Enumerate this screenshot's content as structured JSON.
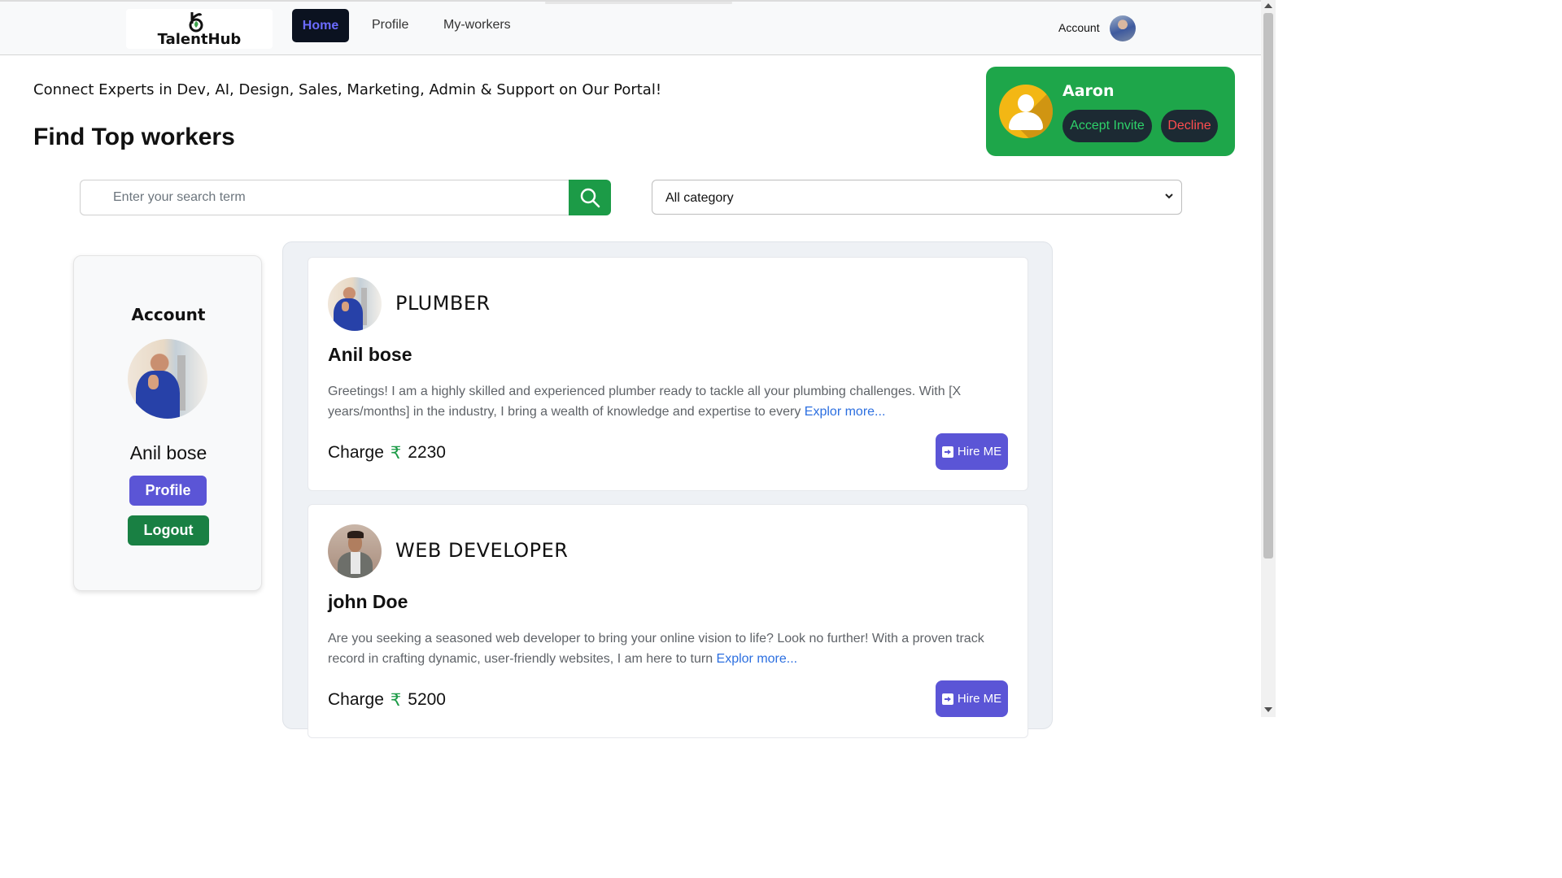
{
  "brand": {
    "name": "TalentHub"
  },
  "nav": {
    "home": "Home",
    "profile": "Profile",
    "my_workers": "My-workers",
    "account": "Account"
  },
  "hero": {
    "tagline": "Connect Experts in Dev, AI, Design, Sales, Marketing, Admin & Support on Our Portal!",
    "heading": "Find Top workers"
  },
  "invite": {
    "name": "Aaron",
    "accept": "Accept Invite",
    "decline": "Decline"
  },
  "search": {
    "placeholder": "Enter your search term",
    "category": "All category"
  },
  "account_card": {
    "title": "Account",
    "name": "Anil bose",
    "profile_button": "Profile",
    "logout_button": "Logout"
  },
  "workers": [
    {
      "role": "PLUMBER",
      "name": "Anil bose",
      "description": "Greetings! I am a highly skilled and experienced plumber ready to tackle all your plumbing challenges. With [X years/months] in the industry, I bring a wealth of knowledge and expertise to every ",
      "more": "Explor more...",
      "charge_label": "Charge",
      "currency": "₹",
      "charge": "2230",
      "hire": "Hire ME"
    },
    {
      "role": "WEB DEVELOPER",
      "name": "john Doe",
      "description": "Are you seeking a seasoned web developer to bring your online vision to life? Look no further! With a proven track record in crafting dynamic, user-friendly websites, I am here to turn ",
      "more": "Explor more...",
      "charge_label": "Charge",
      "currency": "₹",
      "charge": "5200",
      "hire": "Hire ME"
    }
  ],
  "colors": {
    "primary": "#5b55d6",
    "success": "#198043",
    "invite_bg": "#1ea64a",
    "decline_text": "#ff4d4f",
    "link": "#2c6fe0"
  },
  "icons": [
    "talenthub-logo-icon",
    "search-icon",
    "chevron-down-icon",
    "user-placeholder-icon",
    "hire-arrow-icon"
  ]
}
